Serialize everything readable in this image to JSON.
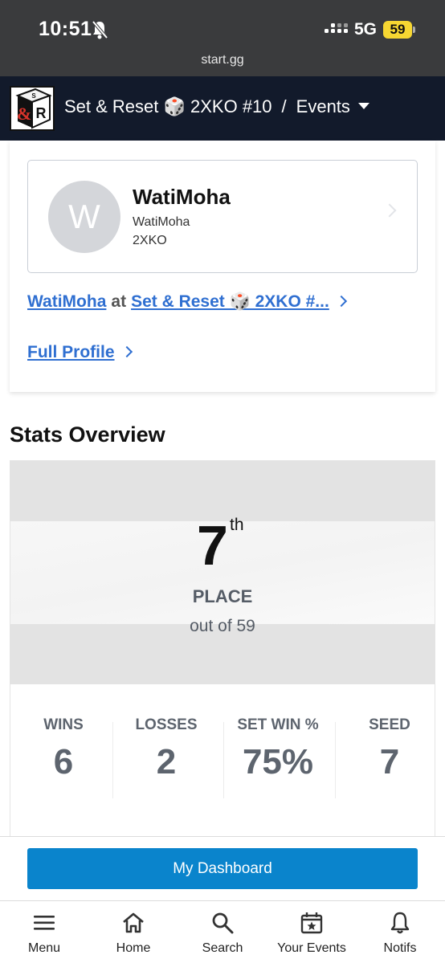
{
  "status_bar": {
    "time": "10:51",
    "network": "5G",
    "battery": "59",
    "url": "start.gg"
  },
  "header": {
    "title": "Set & Reset 🎲 2XKO #10",
    "separator": "/",
    "section": "Events"
  },
  "profile": {
    "avatar_letter": "W",
    "name": "WatiMoha",
    "gamer_tag": "WatiMoha",
    "game": "2XKO",
    "event_link_player": "WatiMoha",
    "event_link_at": "at",
    "event_link_event": "Set & Reset 🎲 2XKO #...",
    "full_profile_label": "Full Profile"
  },
  "stats": {
    "title": "Stats Overview",
    "placement": "7",
    "placement_suffix": "th",
    "placement_label": "PLACE",
    "placement_of": "out of 59",
    "items": [
      {
        "label": "WINS",
        "value": "6"
      },
      {
        "label": "LOSSES",
        "value": "2"
      },
      {
        "label": "SET WIN %",
        "value": "75%"
      },
      {
        "label": "SEED",
        "value": "7"
      }
    ]
  },
  "dashboard_button": "My Dashboard",
  "tabbar": [
    {
      "label": "Menu",
      "icon": "menu-icon"
    },
    {
      "label": "Home",
      "icon": "home-icon"
    },
    {
      "label": "Search",
      "icon": "search-icon"
    },
    {
      "label": "Your Events",
      "icon": "calendar-star-icon"
    },
    {
      "label": "Notifs",
      "icon": "bell-icon"
    }
  ],
  "colors": {
    "header_bg": "#121a2b",
    "link": "#2f6fd1",
    "button": "#0a84cc",
    "battery": "#f7d732"
  }
}
